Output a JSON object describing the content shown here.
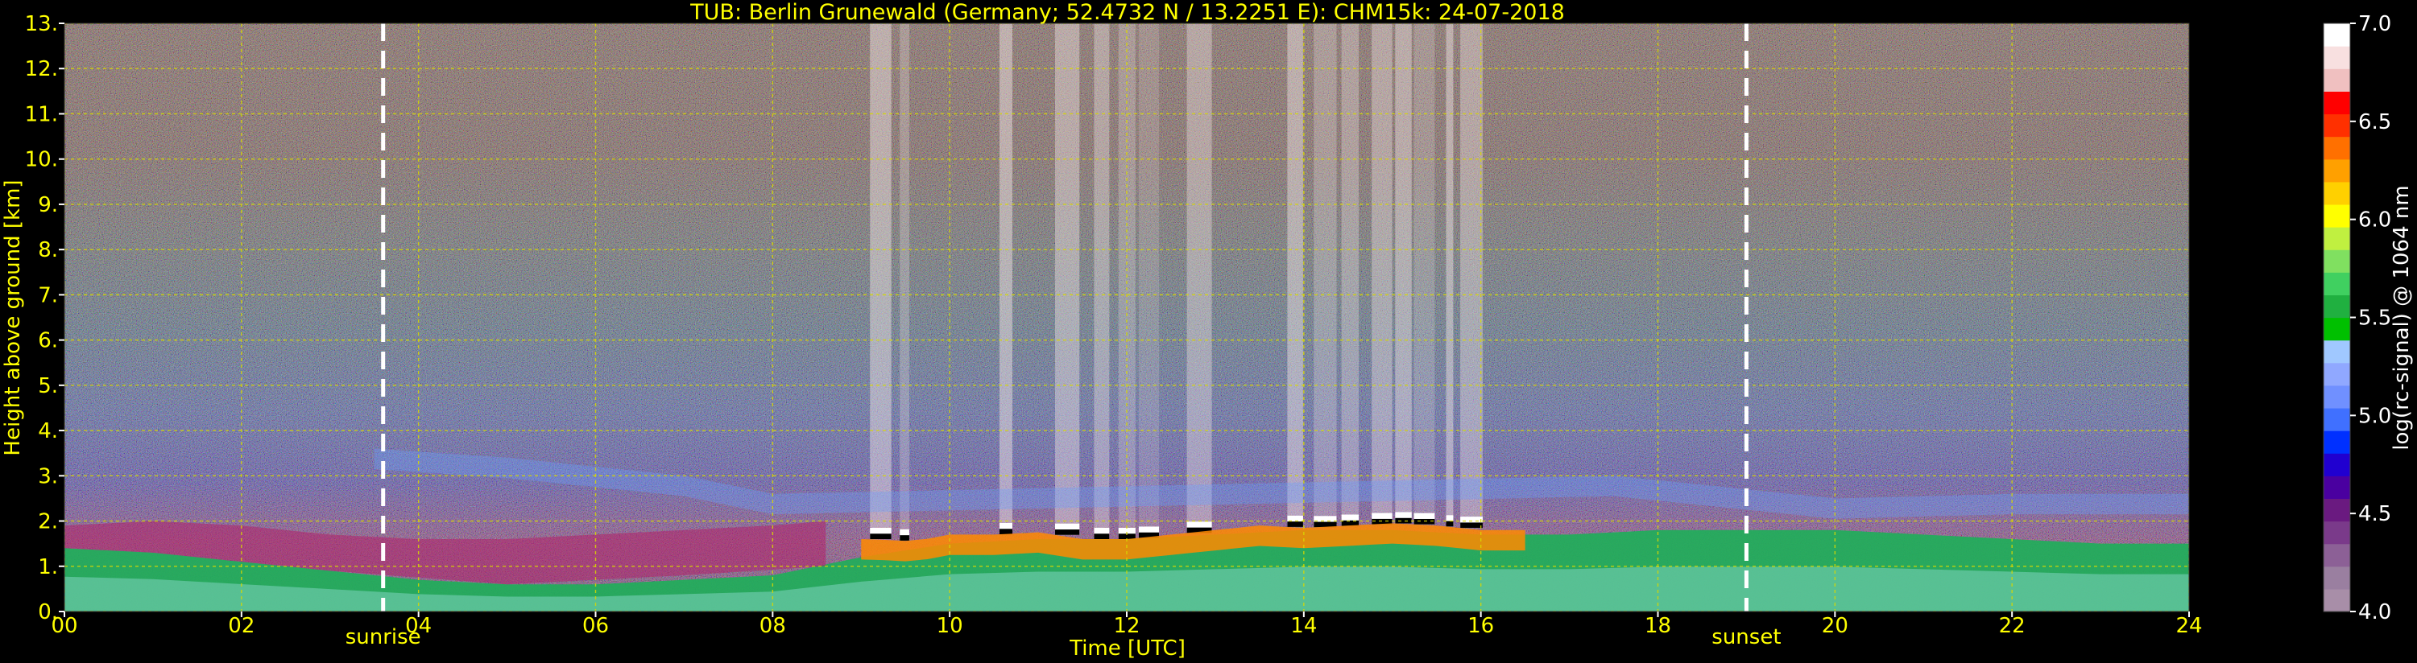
{
  "chart_data": {
    "type": "heatmap",
    "title": "TUB: Berlin Grunewald (Germany; 52.4732 N / 13.2251 E):    CHM15k: 24-07-2018",
    "xlabel": "Time [UTC]",
    "ylabel": "Height above ground [km]",
    "xlim": [
      0,
      24
    ],
    "ylim": [
      0,
      13
    ],
    "x_ticks": [
      "00",
      "02",
      "04",
      "06",
      "08",
      "10",
      "12",
      "14",
      "16",
      "18",
      "20",
      "22",
      "24"
    ],
    "y_ticks": [
      "0.",
      "1.",
      "2.",
      "3.",
      "4.",
      "5.",
      "6.",
      "7.",
      "8.",
      "9.",
      "10.",
      "11.",
      "12.",
      "13."
    ],
    "grid": true,
    "colorbar": {
      "label": "log(rc-signal) @ 1064 nm",
      "range": [
        4.0,
        7.0
      ],
      "ticks": [
        "4.0",
        "4.5",
        "5.0",
        "5.5",
        "6.0",
        "6.5",
        "7.0"
      ],
      "colors": [
        "#a88ea8",
        "#9a7fa0",
        "#8c6096",
        "#7a3a8a",
        "#6a1a80",
        "#4a00a0",
        "#2000d0",
        "#0030ff",
        "#4070ff",
        "#7090ff",
        "#90a8ff",
        "#a0c8ff",
        "#00c000",
        "#20b040",
        "#40d060",
        "#80e060",
        "#c0f040",
        "#ffff00",
        "#ffd000",
        "#ffa000",
        "#ff7000",
        "#ff3000",
        "#ff0000",
        "#f0c0c0",
        "#f8e0e0",
        "#ffffff"
      ]
    },
    "events": [
      {
        "label": "sunrise",
        "time": 3.6
      },
      {
        "label": "sunset",
        "time": 19.0
      }
    ],
    "boundary_layer_top_km": [
      [
        0,
        1.4
      ],
      [
        1,
        1.3
      ],
      [
        2,
        1.1
      ],
      [
        3,
        0.9
      ],
      [
        4,
        0.7
      ],
      [
        5,
        0.6
      ],
      [
        6,
        0.6
      ],
      [
        7,
        0.7
      ],
      [
        8,
        0.8
      ],
      [
        9,
        1.2
      ],
      [
        10,
        1.5
      ],
      [
        11,
        1.6
      ],
      [
        12,
        1.6
      ],
      [
        13,
        1.7
      ],
      [
        14,
        1.8
      ],
      [
        15,
        1.8
      ],
      [
        16,
        1.7
      ],
      [
        17,
        1.7
      ],
      [
        18,
        1.8
      ],
      [
        19,
        1.8
      ],
      [
        20,
        1.8
      ],
      [
        21,
        1.7
      ],
      [
        22,
        1.6
      ],
      [
        23,
        1.5
      ],
      [
        24,
        1.5
      ]
    ],
    "residual_layer_top_km": [
      [
        3.5,
        3.6
      ],
      [
        5,
        3.4
      ],
      [
        7,
        3.0
      ],
      [
        8,
        2.6
      ],
      [
        17.5,
        3.0
      ],
      [
        18.5,
        2.8
      ],
      [
        20,
        2.5
      ],
      [
        22,
        2.6
      ],
      [
        24,
        2.6
      ]
    ],
    "clouds": {
      "time_range": [
        9.1,
        16.2
      ],
      "base_km": [
        [
          9.1,
          1.6
        ],
        [
          9.6,
          1.55
        ],
        [
          10.0,
          1.7
        ],
        [
          10.5,
          1.7
        ],
        [
          11.0,
          1.75
        ],
        [
          11.5,
          1.6
        ],
        [
          12.0,
          1.6
        ],
        [
          12.5,
          1.7
        ],
        [
          13.0,
          1.8
        ],
        [
          13.5,
          1.9
        ],
        [
          14.0,
          1.85
        ],
        [
          14.5,
          1.9
        ],
        [
          15.0,
          1.95
        ],
        [
          15.5,
          1.9
        ],
        [
          16.0,
          1.8
        ]
      ]
    }
  }
}
